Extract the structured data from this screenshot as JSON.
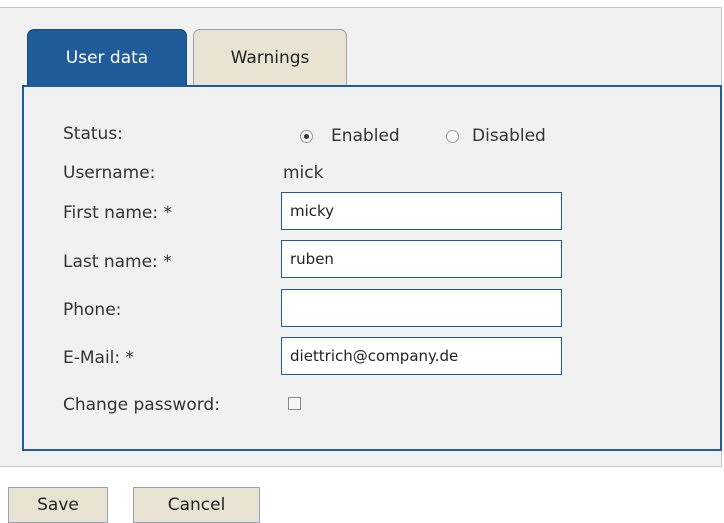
{
  "tabs": [
    {
      "label": "User data",
      "active": true
    },
    {
      "label": "Warnings",
      "active": false
    }
  ],
  "form": {
    "status": {
      "label": "Status:",
      "options": [
        "Enabled",
        "Disabled"
      ],
      "selected": "Enabled"
    },
    "username": {
      "label": "Username:",
      "value": "mick"
    },
    "first_name": {
      "label": "First name: *",
      "value": "micky"
    },
    "last_name": {
      "label": "Last name: *",
      "value": "ruben"
    },
    "phone": {
      "label": "Phone:",
      "value": ""
    },
    "email": {
      "label": "E-Mail: *",
      "value": "diettrich@company.de"
    },
    "change_password": {
      "label": "Change password:",
      "checked": false
    }
  },
  "buttons": {
    "save": "Save",
    "cancel": "Cancel"
  },
  "colors": {
    "accent": "#1f5c99",
    "tab_inactive": "#e8e3d3",
    "panel_bg": "#f1f1f1"
  }
}
